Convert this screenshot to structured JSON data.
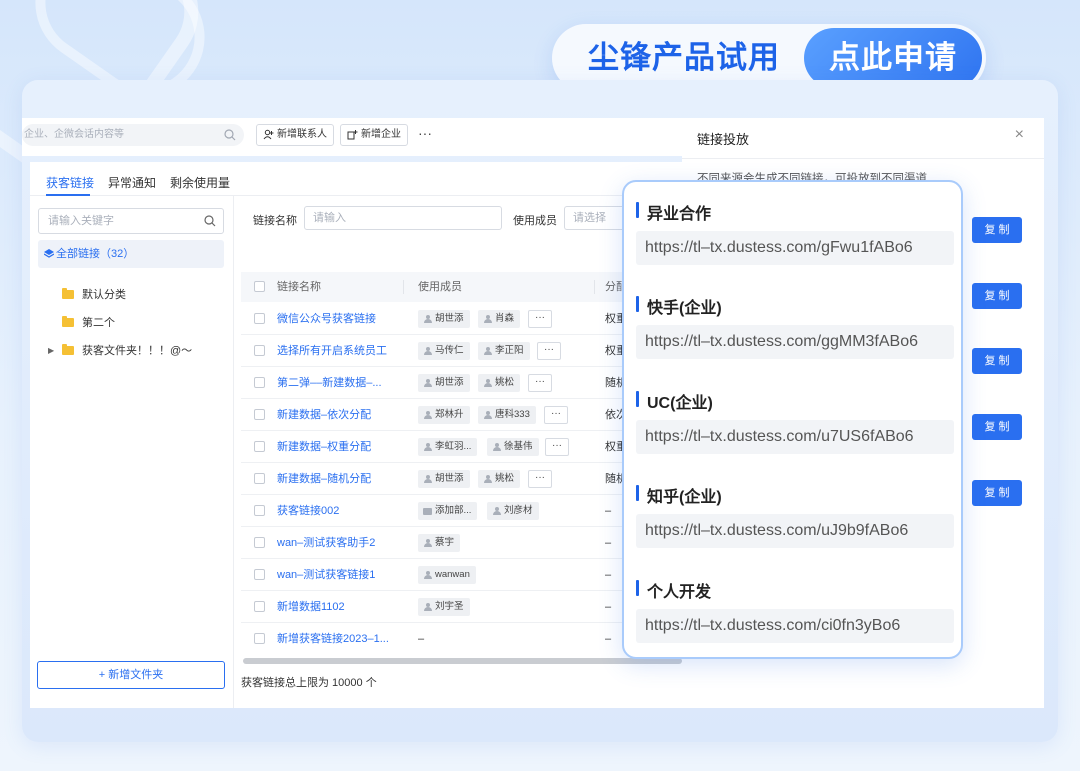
{
  "promo": {
    "title": "尘锋产品试用",
    "cta": "点此申请"
  },
  "topbar": {
    "search_placeholder": "企业、企微会话内容等",
    "add_contact": "新增联系人",
    "add_company": "新增企业",
    "more": "···"
  },
  "tabs": [
    "获客链接",
    "异常通知",
    "剩余使用量"
  ],
  "left": {
    "keyword_placeholder": "请输入关键字",
    "all_links": "全部链接（32）",
    "folders": [
      "默认分类",
      "第二个",
      "获客文件夹！！！@～"
    ],
    "new_folder": "新增文件夹",
    "new_folder_plus": "+"
  },
  "filters": {
    "name_label": "链接名称",
    "name_placeholder": "请输入",
    "member_label": "使用成员",
    "member_placeholder": "请选择"
  },
  "table": {
    "headers": [
      "链接名称",
      "使用成员",
      "分配"
    ],
    "rows": [
      {
        "name": "微信公众号获客链接",
        "members": [
          "胡世添",
          "肖森"
        ],
        "more": "···",
        "dist": "权重"
      },
      {
        "name": "选择所有开启系统员工",
        "members": [
          "马传仁",
          "李正阳"
        ],
        "more": "···",
        "dist": "权重"
      },
      {
        "name": "第二弹––新建数据–...",
        "members": [
          "胡世添",
          "姚松"
        ],
        "more": "···",
        "dist": "随机"
      },
      {
        "name": "新建数据–依次分配",
        "members": [
          "郑林升",
          "唐科333"
        ],
        "more": "···",
        "dist": "依次"
      },
      {
        "name": "新建数据–权重分配",
        "members": [
          "李虹羽...",
          "徐基伟"
        ],
        "more": "···",
        "dist": "权重"
      },
      {
        "name": "新建数据–随机分配",
        "members": [
          "胡世添",
          "姚松"
        ],
        "more": "···",
        "dist": "随机"
      },
      {
        "name": "获客链接002",
        "members": [
          "添加部...",
          "刘彦材"
        ],
        "dist": "–"
      },
      {
        "name": "wan–测试获客助手2",
        "members": [
          "蔡宇"
        ],
        "dist": "–"
      },
      {
        "name": "wan–测试获客链接1",
        "members": [
          "wanwan"
        ],
        "dist": "–"
      },
      {
        "name": "新增数据1102",
        "members": [
          "刘宇圣"
        ],
        "dist": "–"
      },
      {
        "name": "新增获客链接2023–1...",
        "members_text": "–",
        "dist": "–"
      }
    ],
    "footer": "获客链接总上限为 10000 个"
  },
  "drawer": {
    "title": "链接投放",
    "close": "×",
    "desc": "不同来源会生成不同链接，可投放到不同渠道",
    "copy_label": "复 制"
  },
  "channels": [
    {
      "name": "异业合作",
      "url": "https://tl–tx.dustess.com/gFwu1fABo6"
    },
    {
      "name": "快手(企业)",
      "url": "https://tl–tx.dustess.com/ggMM3fABo6"
    },
    {
      "name": "UC(企业)",
      "url": "https://tl–tx.dustess.com/u7US6fABo6"
    },
    {
      "name": "知乎(企业)",
      "url": "https://tl–tx.dustess.com/uJ9b9fABo6"
    },
    {
      "name": "个人开发",
      "url": "https://tl–tx.dustess.com/ci0fn3yBo6"
    }
  ],
  "colors": {
    "primary": "#2a6ff0",
    "brand": "#1d63e8",
    "card_border": "#a9cbfb"
  }
}
